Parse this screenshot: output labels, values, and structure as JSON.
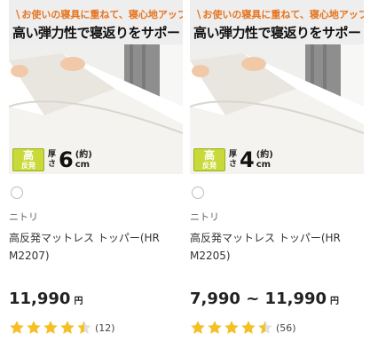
{
  "products": [
    {
      "promo_line1": "お使いの寝具に重ねて、寝心地アップ",
      "promo_line2": "高い弾力性で寝返りをサポート",
      "badge_big": "高",
      "badge_small": "反発",
      "thick_label_a": "厚",
      "thick_label_b": "さ",
      "thick_value": "6",
      "thick_approx": "(約)",
      "thick_unit": "cm",
      "brand": "ニトリ",
      "title": "高反発マットレス トッパー(HR M2207)",
      "price": "11,990",
      "currency": "円",
      "rating": 4.5,
      "review_count": "(12)"
    },
    {
      "promo_line1": "お使いの寝具に重ねて、寝心地アップ",
      "promo_line2": "高い弾力性で寝返りをサポート",
      "badge_big": "高",
      "badge_small": "反発",
      "thick_label_a": "厚",
      "thick_label_b": "さ",
      "thick_value": "4",
      "thick_approx": "(約)",
      "thick_unit": "cm",
      "brand": "ニトリ",
      "title": "高反発マットレス トッパー(HR M2205)",
      "price": "7,990 ~ 11,990",
      "currency": "円",
      "rating": 4.5,
      "review_count": "(56)"
    }
  ],
  "colors": {
    "star": "#f5c026",
    "star_empty": "#e0e0e0",
    "promo_accent": "#e5751f",
    "badge": "#c9d93a"
  }
}
